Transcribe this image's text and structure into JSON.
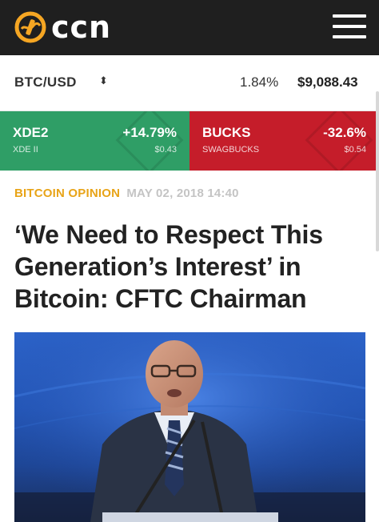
{
  "header": {
    "logo_text": "ccn",
    "brand_color": "#f5a623"
  },
  "ticker": {
    "pair": "BTC/USD",
    "change": "1.84%",
    "price": "$9,088.43"
  },
  "coins": [
    {
      "symbol": "XDE2",
      "name": "XDE II",
      "change": "+14.79%",
      "price": "$0.43",
      "color": "#2f9e66"
    },
    {
      "symbol": "BUCKS",
      "name": "SWAGBUCKS",
      "change": "-32.6%",
      "price": "$0.54",
      "color": "#c51d2a"
    }
  ],
  "article": {
    "category": "BITCOIN OPINION",
    "date": "MAY 02, 2018 14:40",
    "headline": "‘We Need to Respect This Generation’s Interest’ in Bitcoin: CFTC Chairman"
  }
}
